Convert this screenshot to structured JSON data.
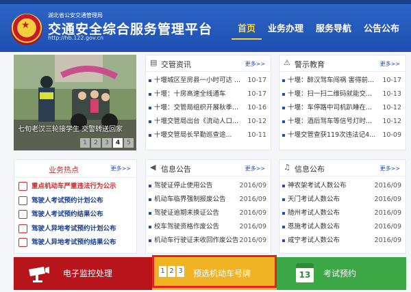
{
  "header": {
    "org": "湖北省公安交通管理局",
    "title": "交通安全综合服务管理平台",
    "url": "http://hb.122.gov.cn",
    "nav": [
      "首页",
      "业务办理",
      "服务导航",
      "公告公布"
    ]
  },
  "slideshow": {
    "caption": "七旬老汉三轮接学生 交警转送回家",
    "pages": [
      "1",
      "2",
      "3",
      "4",
      "5"
    ],
    "active_page": "4"
  },
  "traffic_news": {
    "title": "交管资讯",
    "more": "更多>>",
    "items": [
      {
        "text": "十堰城区至房县一小时可达 ...",
        "date": "10-17"
      },
      {
        "text": "十堰：十房高速全线通车",
        "date": "10-17"
      },
      {
        "text": "十堰：交管局组织开展秋季...",
        "date": "10-16"
      },
      {
        "text": "十堰交管局出台《流动人口...",
        "date": "10-12"
      },
      {
        "text": "十堰交管局长早勤巡查途...",
        "date": "10-11"
      }
    ]
  },
  "warning_education": {
    "title": "警示教育",
    "more": "更多>>",
    "items": [
      {
        "text": "十堰：醉汉驾车闯祸 害得前...",
        "date": "10-17"
      },
      {
        "text": "十堰：扫一扫二维码就能交...",
        "date": "10-13"
      },
      {
        "text": "十堰：车停路中司机趴睡在...",
        "date": "10-12"
      },
      {
        "text": "十堰：酒后驾车等信号灯时...",
        "date": "10-12"
      },
      {
        "text": "十堰交管查获119次违法记4...",
        "date": "10-09"
      }
    ]
  },
  "hot_topics": {
    "title": "业务热点",
    "more": "更多>>",
    "items": [
      "重点机动车严重违法行为公示",
      "驾驶人考试预约计划公布",
      "驾驶人考试预约结果公布",
      "驾驶人异地考试预约计划公布",
      "驾驶人异地考试预约结果公布"
    ]
  },
  "info_notice": {
    "title": "信息公告",
    "more": "更多>>",
    "items": [
      {
        "text": "驾驶证停止使用公告",
        "date": "2016/09"
      },
      {
        "text": "机动车临界强制报废公告",
        "date": "2016/09"
      },
      {
        "text": "驾驶证逾期未换证公告",
        "date": "2016/09"
      },
      {
        "text": "校车驾驶资格作废公告",
        "date": "2016/09"
      },
      {
        "text": "机动车行驶证未收回作废公告",
        "date": "2016/09"
      }
    ]
  },
  "info_publish": {
    "title": "信息公布",
    "more": "更多>>",
    "items": [
      {
        "text": "神农架考试人数公布",
        "date": "2016/09"
      },
      {
        "text": "天门考试人数公布",
        "date": "2016/09"
      },
      {
        "text": "随州考试人数公布",
        "date": "2016/09"
      },
      {
        "text": "恩施考试人数公布",
        "date": "2016/09"
      },
      {
        "text": "咸宁考试人数公布",
        "date": "2016/09"
      }
    ]
  },
  "bottom_bar": {
    "electronic_monitoring": "电子监控处理",
    "plate_preselect": "预选机动车号牌",
    "plate_digits": [
      "1",
      "2",
      "3"
    ],
    "exam_booking": "考试预约",
    "calendar_day": "13",
    "colors": {
      "red": "#b8141b",
      "yellow": "#f0b323",
      "green": "#3ba845",
      "highlight": "#e5231c"
    }
  }
}
